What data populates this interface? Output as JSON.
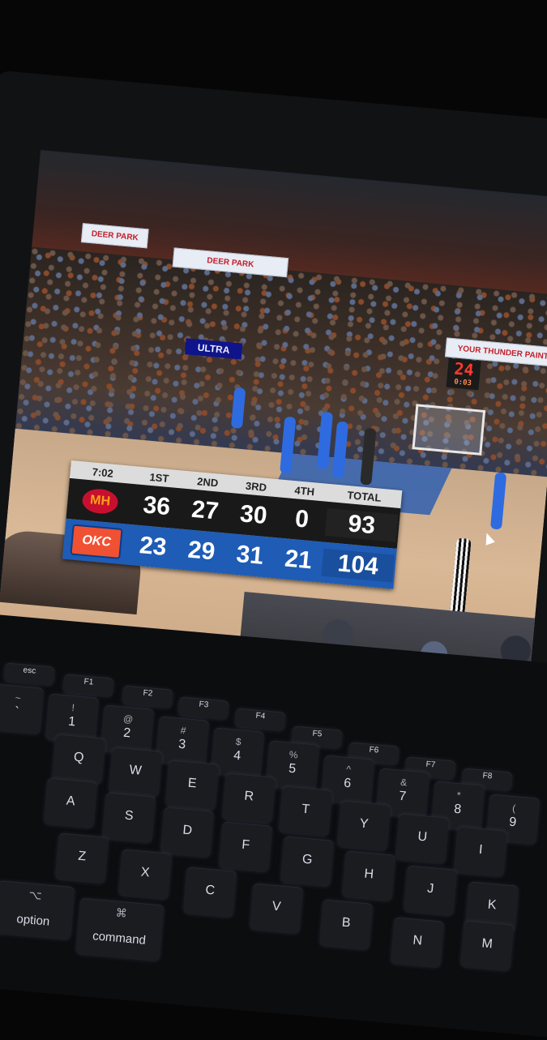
{
  "banners": {
    "left": "DEER PARK",
    "middle": "DEER PARK",
    "ultra": "ULTRA",
    "right": "YOUR THUNDER PAINT"
  },
  "shot_clock": {
    "value": "24",
    "game_clock": "0:03"
  },
  "scoreboard": {
    "game_clock": "7:02",
    "periods": [
      "1ST",
      "2ND",
      "3RD",
      "4TH"
    ],
    "total_label": "TOTAL",
    "teams": [
      {
        "logo": "heat-logo",
        "logo_text": "MH",
        "scores": [
          "36",
          "27",
          "30",
          "0"
        ],
        "total": "93"
      },
      {
        "logo": "okc-logo",
        "logo_text": "OKC",
        "scores": [
          "23",
          "29",
          "31",
          "21"
        ],
        "total": "104"
      }
    ]
  },
  "keyboard": {
    "fn_row": [
      "esc",
      "F1",
      "F2",
      "F3",
      "F4",
      "F5",
      "F6",
      "F7",
      "F8"
    ],
    "number_row": [
      {
        "top": "~",
        "main": "`"
      },
      {
        "top": "!",
        "main": "1"
      },
      {
        "top": "@",
        "main": "2"
      },
      {
        "top": "#",
        "main": "3"
      },
      {
        "top": "$",
        "main": "4"
      },
      {
        "top": "%",
        "main": "5"
      },
      {
        "top": "^",
        "main": "6"
      },
      {
        "top": "&",
        "main": "7"
      },
      {
        "top": "*",
        "main": "8"
      },
      {
        "top": "(",
        "main": "9"
      }
    ],
    "top_row": [
      "Q",
      "W",
      "E",
      "R",
      "T",
      "Y",
      "U",
      "I"
    ],
    "home_row": [
      "A",
      "S",
      "D",
      "F",
      "G",
      "H",
      "J",
      "K"
    ],
    "bottom_row": [
      "Z",
      "X",
      "C",
      "V",
      "B",
      "N",
      "M"
    ],
    "option": {
      "symbol": "⌥",
      "label": "option"
    },
    "command": {
      "symbol": "⌘",
      "label": "command"
    }
  }
}
